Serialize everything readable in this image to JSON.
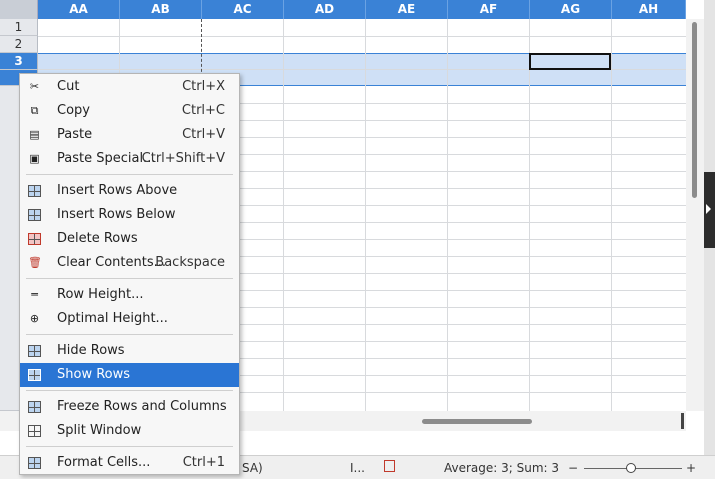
{
  "columns": [
    "AA",
    "AB",
    "AC",
    "AD",
    "AE",
    "AF",
    "AG",
    "AH"
  ],
  "rows": [
    "1",
    "2",
    "3"
  ],
  "selected_row": "3",
  "context_menu": {
    "items": [
      {
        "label": "Cut",
        "shortcut": "Ctrl+X",
        "icon": "scissors-icon"
      },
      {
        "label": "Copy",
        "shortcut": "Ctrl+C",
        "icon": "copy-icon"
      },
      {
        "label": "Paste",
        "shortcut": "Ctrl+V",
        "icon": "paste-icon"
      },
      {
        "label": "Paste Special...",
        "shortcut": "Ctrl+Shift+V",
        "icon": "paste-special-icon"
      },
      {
        "label": "Insert Rows Above",
        "shortcut": "",
        "icon": "insert-rows-above-icon"
      },
      {
        "label": "Insert Rows Below",
        "shortcut": "",
        "icon": "insert-rows-below-icon"
      },
      {
        "label": "Delete Rows",
        "shortcut": "",
        "icon": "delete-rows-icon"
      },
      {
        "label": "Clear Contents...",
        "shortcut": "Backspace",
        "icon": "trash-icon"
      },
      {
        "label": "Row Height...",
        "shortcut": "",
        "icon": "row-height-icon"
      },
      {
        "label": "Optimal Height...",
        "shortcut": "",
        "icon": "optimal-height-icon"
      },
      {
        "label": "Hide Rows",
        "shortcut": "",
        "icon": "hide-rows-icon"
      },
      {
        "label": "Show Rows",
        "shortcut": "",
        "icon": "show-rows-icon",
        "highlighted": true
      },
      {
        "label": "Freeze Rows and Columns",
        "shortcut": "",
        "icon": "freeze-icon"
      },
      {
        "label": "Split Window",
        "shortcut": "",
        "icon": "split-window-icon"
      },
      {
        "label": "Format Cells...",
        "shortcut": "Ctrl+1",
        "icon": "format-cells-icon"
      }
    ]
  },
  "statusbar": {
    "language_fragment": "SA)",
    "selection_mode": "I...",
    "summary": "Average: 3; Sum: 3",
    "zoom_minus": "−",
    "zoom_plus": "+"
  },
  "colors": {
    "accent": "#3a82d6",
    "highlight": "#2a75d4",
    "selection_band": "#cfe0f6"
  }
}
